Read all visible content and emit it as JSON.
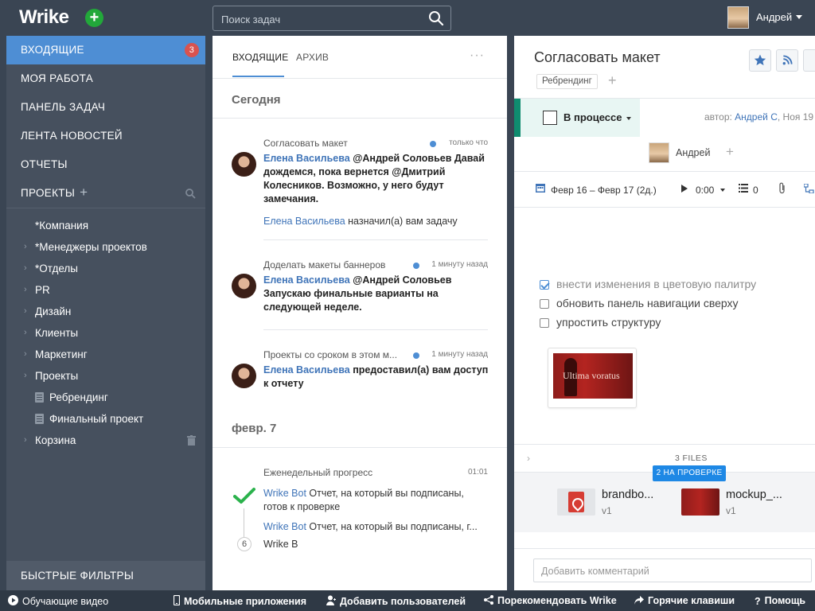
{
  "app": {
    "logo": "Wrike"
  },
  "search": {
    "placeholder": "Поиск задач"
  },
  "user": {
    "name": "Андрей"
  },
  "sidebar": {
    "nav": [
      {
        "label": "ВХОДЯЩИЕ",
        "badge": "3",
        "active": true
      },
      {
        "label": "МОЯ РАБОТА"
      },
      {
        "label": "ПАНЕЛЬ ЗАДАЧ"
      },
      {
        "label": "ЛЕНТА НОВОСТЕЙ"
      },
      {
        "label": "ОТЧЕТЫ"
      },
      {
        "label": "ПРОЕКТЫ"
      }
    ],
    "tree": [
      {
        "label": "*Компания",
        "expandable": false
      },
      {
        "label": "*Менеджеры проектов",
        "expandable": true
      },
      {
        "label": "*Отделы",
        "expandable": true
      },
      {
        "label": "PR",
        "expandable": true
      },
      {
        "label": "Дизайн",
        "expandable": true
      },
      {
        "label": "Клиенты",
        "expandable": true
      },
      {
        "label": "Маркетинг",
        "expandable": true
      },
      {
        "label": "Проекты",
        "expandable": true
      },
      {
        "label": "Ребрендинг",
        "type": "doc"
      },
      {
        "label": "Финальный проект",
        "type": "doc"
      },
      {
        "label": "Корзина",
        "expandable": true
      }
    ],
    "quick_filters": "БЫСТРЫЕ ФИЛЬТРЫ"
  },
  "inbox": {
    "tabs": [
      "ВХОДЯЩИЕ",
      "АРХИВ"
    ],
    "more": "···",
    "groups": [
      {
        "day": "Сегодня",
        "items": [
          {
            "task": "Согласовать макет",
            "time": "только что",
            "author": "Елена Васильева",
            "message": " @Андрей Соловьев Давай дождемся, пока вернется @Дмитрий Колесников. Возможно, у него будут замечания.",
            "sub_author": "Елена Васильева",
            "sub_text": " назначил(а) вам задачу"
          },
          {
            "task": "Доделать макеты баннеров",
            "time": "1 минуту назад",
            "author": "Елена Васильева",
            "message": " @Андрей Соловьев Запускаю финальные варианты на следующей неделе."
          },
          {
            "task": "Проекты со сроком в этом м...",
            "time": "1 минуту назад",
            "author": "Елена Васильева",
            "message": " предоставил(а) вам доступ к отчету"
          }
        ]
      },
      {
        "day": "февр. 7",
        "items": [
          {
            "task": "Еженедельный прогресс",
            "time": "01:01",
            "author": "Wrike Bot",
            "message": " Отчет, на который вы подписаны, готов к проверке",
            "author2": "Wrike Bot",
            "message2": " Отчет, на который вы подписаны, г...",
            "count": "6",
            "last": "Wrike B"
          }
        ]
      }
    ]
  },
  "task": {
    "title": "Согласовать макет",
    "tag": "Ребрендинг",
    "status": "В процессе",
    "author_prefix": "автор: ",
    "author_name": "Андрей С",
    "author_date": ", Ноя 19",
    "assignee": "Андрей",
    "dates": "Февр 16 – Февр 17 (2д.)",
    "timer": "0:00",
    "subtasks": "0",
    "checklist": [
      {
        "text": "внести изменения в цветовую палитру",
        "done": true
      },
      {
        "text": "обновить панель навигации сверху",
        "done": false
      },
      {
        "text": "упростить структуру",
        "done": false
      }
    ],
    "preview_text": "Ultima voratus",
    "files_count": "3 FILES",
    "review_badge": "2 НА ПРОВЕРКЕ",
    "files": [
      {
        "name": "brandbo...",
        "version": "v1",
        "kind": "pdf"
      },
      {
        "name": "mockup_...",
        "version": "v1",
        "kind": "image"
      }
    ],
    "comment_placeholder": "Добавить комментарий"
  },
  "footer": [
    {
      "label": "Обучающие видео",
      "icon": "play-circle-icon"
    },
    {
      "label": "Мобильные приложения",
      "icon": "mobile-icon"
    },
    {
      "label": "Добавить пользователей",
      "icon": "add-user-icon"
    },
    {
      "label": "Порекомендовать Wrike",
      "icon": "share-icon"
    },
    {
      "label": "Горячие клавиши",
      "icon": "shortcut-icon"
    },
    {
      "label": "Помощь",
      "icon": "help-icon"
    }
  ],
  "colors": {
    "accent": "#4e8ed4",
    "sidebar": "#46505e",
    "topbar": "#3a4553",
    "status": "#0f8c6f",
    "badge": "#d9534f",
    "add": "#22a83a"
  }
}
